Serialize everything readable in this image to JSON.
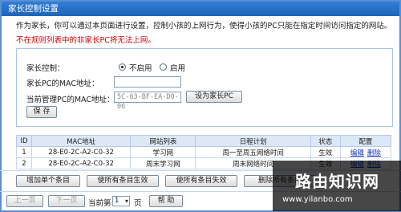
{
  "title": "家长控制设置",
  "intro": "作为家长，你可以通过本页面进行设置，控制小孩的上网行为，使得小孩的PC只能在指定时间访问指定的网站。",
  "warning": "不在规则列表中的非家长PC将无法上网。",
  "form": {
    "control_label": "家长控制：",
    "radio_off": "不启用",
    "radio_on": "启用",
    "selected": "不启用",
    "parent_mac_label": "家长PC的MAC地址：",
    "parent_mac_value": "",
    "current_mac_label": "当前管理PC的MAC地址：",
    "current_mac_value": "5C-63-BF-EA-D0-06",
    "set_parent_button": "设为家长PC",
    "save_button": "保 存"
  },
  "table": {
    "headers": [
      "ID",
      "MAC地址",
      "网站列表",
      "日程计划",
      "状态",
      "配置"
    ],
    "rows": [
      {
        "id": "1",
        "mac": "28-E0-2C-A2-C0-32",
        "site": "学习网",
        "schedule": "周一至周五网络时间",
        "status": "生效",
        "edit": "编辑",
        "del": "删除"
      },
      {
        "id": "2",
        "mac": "28-E0-2C-A2-C0-32",
        "site": "周末学习网",
        "schedule": "周末网络时间",
        "status": "生效",
        "edit": "编辑",
        "del": "删除"
      }
    ]
  },
  "actions": {
    "add": "增加单个条目",
    "enable_all": "使所有条目生效",
    "disable_all": "使所有条目失效",
    "delete_all": "删除所有条目"
  },
  "pager": {
    "prev": "上一页",
    "next": "下一页",
    "current_label": "当前第",
    "page": "1",
    "page_unit": "页",
    "help": "帮 助"
  },
  "watermark": {
    "title": "路由知识网",
    "url": "www.yilanbo.com"
  }
}
